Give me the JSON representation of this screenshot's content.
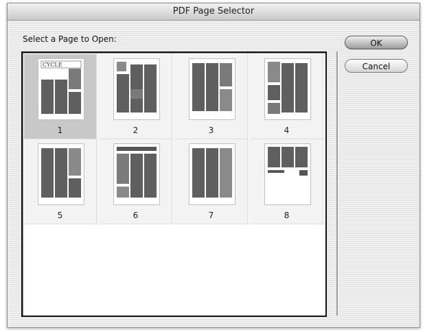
{
  "window": {
    "title": "PDF Page Selector"
  },
  "prompt": "Select a Page to Open:",
  "pages": [
    {
      "label": "1",
      "selected": true
    },
    {
      "label": "2",
      "selected": false
    },
    {
      "label": "3",
      "selected": false
    },
    {
      "label": "4",
      "selected": false
    },
    {
      "label": "5",
      "selected": false
    },
    {
      "label": "6",
      "selected": false
    },
    {
      "label": "7",
      "selected": false
    },
    {
      "label": "8",
      "selected": false
    }
  ],
  "buttons": {
    "ok": "OK",
    "cancel": "Cancel"
  },
  "thumbnail_masthead": "CYCLE",
  "colors": {
    "window_bg": "#e6e6e6",
    "selected_cell": "#c8c8c8",
    "thumb_accent": "#7a7a7a",
    "text_block": "#2a2a2a"
  }
}
